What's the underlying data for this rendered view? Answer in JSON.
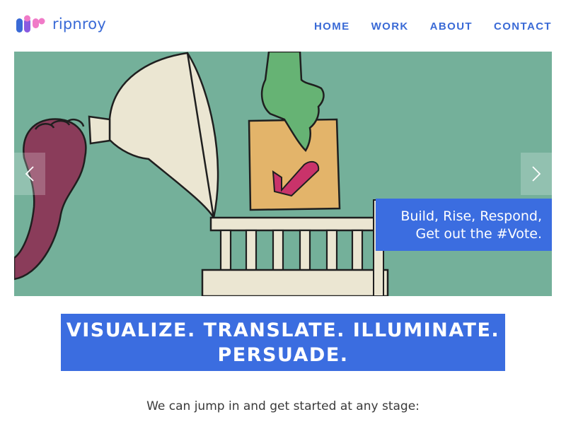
{
  "brand": {
    "name": "ripnroy",
    "colors": {
      "blue": "#3a6ad6",
      "pink": "#f07ac8"
    }
  },
  "nav": {
    "items": [
      {
        "label": "HOME"
      },
      {
        "label": "WORK"
      },
      {
        "label": "ABOUT"
      },
      {
        "label": "CONTACT"
      }
    ]
  },
  "hero": {
    "caption_line1": "Build, Rise, Respond,",
    "caption_line2": "Get out the #Vote.",
    "prev_icon": "chevron-left-icon",
    "next_icon": "chevron-right-icon",
    "background_color": "#74b09a"
  },
  "banner": {
    "line1": "VISUALIZE. TRANSLATE. ILLUMINATE.",
    "line2": "PERSUADE.",
    "color": "#3b6de0"
  },
  "intro": {
    "text": "We can jump in and get started at any stage:"
  }
}
